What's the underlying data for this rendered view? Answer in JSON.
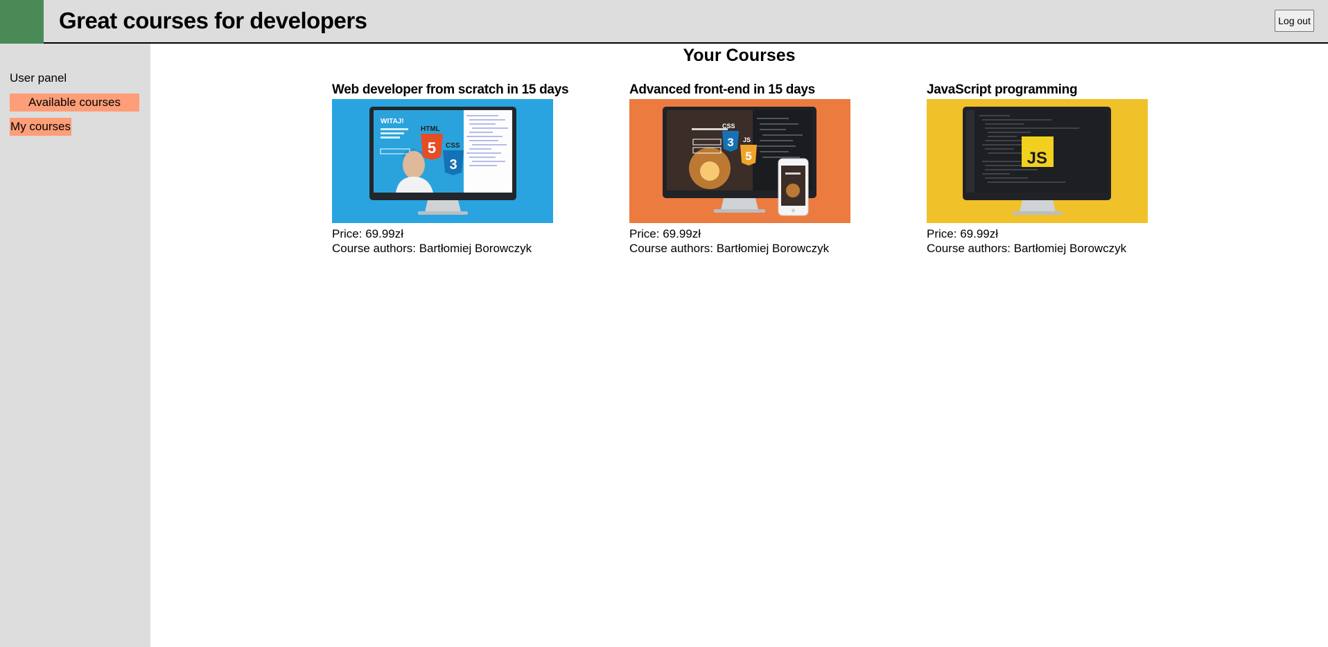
{
  "header": {
    "title": "Great courses for developers",
    "logout_label": "Log out"
  },
  "sidebar": {
    "panel_label": "User panel",
    "items": [
      {
        "label": "Available courses"
      },
      {
        "label": "My courses"
      }
    ]
  },
  "main": {
    "title": "Your Courses",
    "price_prefix": "Price: ",
    "authors_prefix": "Course authors: ",
    "courses": [
      {
        "title": "Web developer from scratch in 15 days",
        "price": "69.99zł",
        "authors": "Bartłomiej Borowczyk",
        "thumb_color": "#29a4e0",
        "screen_text": [
          "WITAJ!",
          "HTML",
          "CSS"
        ],
        "badge_numbers": [
          "5",
          "3"
        ]
      },
      {
        "title": "Advanced front-end in 15 days",
        "price": "69.99zł",
        "authors": "Bartłomiej Borowczyk",
        "thumb_color": "#ec7b40",
        "screen_text": [
          "CSS",
          "JS"
        ],
        "badge_numbers": [
          "3",
          "5"
        ]
      },
      {
        "title": "JavaScript programming",
        "price": "69.99zł",
        "authors": "Bartłomiej Borowczyk",
        "thumb_color": "#f1c12a",
        "screen_text": [
          "JS"
        ]
      }
    ]
  },
  "colors": {
    "header_bg": "#dddddd",
    "logo_green": "#4a8a57",
    "link_bg": "#fe9e78"
  }
}
